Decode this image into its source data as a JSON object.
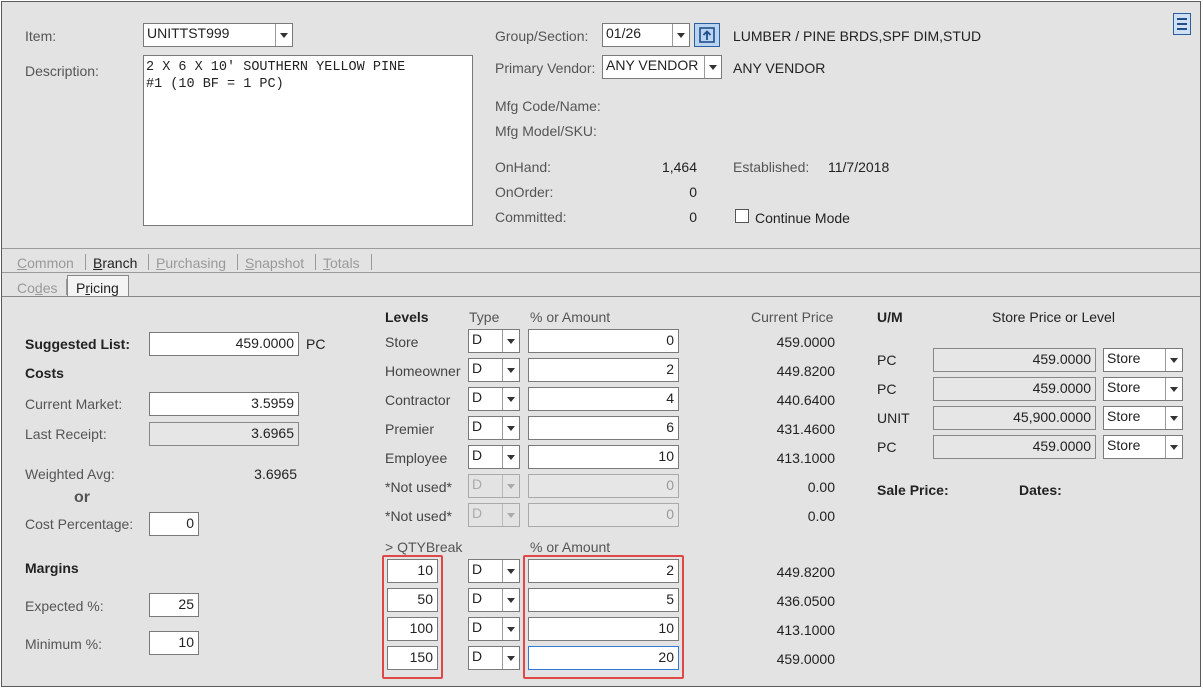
{
  "header": {
    "item_label": "Item:",
    "item_value": "UNITTST999",
    "description_label": "Description:",
    "description_value": "2 X 6 X 10' SOUTHERN YELLOW PINE\n#1 (10 BF = 1 PC)",
    "group_section_label": "Group/Section:",
    "group_section_value": "01/26",
    "group_section_desc": "LUMBER / PINE BRDS,SPF DIM,STUD",
    "primary_vendor_label": "Primary Vendor:",
    "primary_vendor_value": "ANY VENDOR",
    "primary_vendor_desc": "ANY VENDOR",
    "mfg_code_label": "Mfg Code/Name:",
    "mfg_model_label": "Mfg Model/SKU:",
    "onhand_label": "OnHand:",
    "onhand_value": "1,464",
    "onorder_label": "OnOrder:",
    "onorder_value": "0",
    "committed_label": "Committed:",
    "committed_value": "0",
    "established_label": "Established:",
    "established_value": "11/7/2018",
    "continue_mode_label": "Continue Mode",
    "continue_mode_checked": false
  },
  "tabs": [
    {
      "pre": "",
      "u": "C",
      "post": "ommon",
      "active": false
    },
    {
      "pre": "",
      "u": "B",
      "post": "ranch",
      "active": true
    },
    {
      "pre": "",
      "u": "P",
      "post": "urchasing",
      "active": false
    },
    {
      "pre": "",
      "u": "S",
      "post": "napshot",
      "active": false
    },
    {
      "pre": "",
      "u": "T",
      "post": "otals",
      "active": false
    }
  ],
  "subtabs": [
    {
      "pre": "Co",
      "u": "d",
      "post": "es",
      "active": false
    },
    {
      "pre": "P",
      "u": "r",
      "post": "icing",
      "active": true
    }
  ],
  "pricing": {
    "suggested_list_label": "Suggested List:",
    "suggested_list_value": "459.0000",
    "suggested_list_um": "PC",
    "costs_label": "Costs",
    "current_market_label": "Current Market:",
    "current_market_value": "3.5959",
    "last_receipt_label": "Last Receipt:",
    "last_receipt_value": "3.6965",
    "weighted_avg_label": "Weighted Avg:",
    "weighted_avg_value": "3.6965",
    "or_label": "or",
    "cost_percentage_label": "Cost Percentage:",
    "cost_percentage_value": "0",
    "margins_label": "Margins",
    "expected_label": "Expected %:",
    "expected_value": "25",
    "minimum_label": "Minimum %:",
    "minimum_value": "10"
  },
  "levels": {
    "levels_header": "Levels",
    "type_header": "Type",
    "amount_header": "% or Amount",
    "current_price_header": "Current Price",
    "rows": [
      {
        "name": "Store",
        "type": "D",
        "amount": "0",
        "price": "459.0000",
        "disabled": false
      },
      {
        "name": "Homeowner",
        "type": "D",
        "amount": "2",
        "price": "449.8200",
        "disabled": false
      },
      {
        "name": "Contractor",
        "type": "D",
        "amount": "4",
        "price": "440.6400",
        "disabled": false
      },
      {
        "name": "Premier",
        "type": "D",
        "amount": "6",
        "price": "431.4600",
        "disabled": false
      },
      {
        "name": "Employee",
        "type": "D",
        "amount": "10",
        "price": "413.1000",
        "disabled": false
      },
      {
        "name": "*Not used*",
        "type": "D",
        "amount": "0",
        "price": "0.00",
        "disabled": true
      },
      {
        "name": "*Not used*",
        "type": "D",
        "amount": "0",
        "price": "0.00",
        "disabled": true
      }
    ]
  },
  "qtybreak": {
    "qty_header": "> QTYBreak",
    "amount_header": "% or Amount",
    "rows": [
      {
        "qty": "10",
        "type": "D",
        "amount": "2",
        "price": "449.8200"
      },
      {
        "qty": "50",
        "type": "D",
        "amount": "5",
        "price": "436.0500"
      },
      {
        "qty": "100",
        "type": "D",
        "amount": "10",
        "price": "413.1000"
      },
      {
        "qty": "150",
        "type": "D",
        "amount": "20",
        "price": "459.0000"
      }
    ]
  },
  "um": {
    "um_header": "U/M",
    "store_price_header": "Store Price or Level",
    "rows": [
      {
        "um": "PC",
        "price": "459.0000",
        "level": "Store"
      },
      {
        "um": "PC",
        "price": "459.0000",
        "level": "Store"
      },
      {
        "um": "UNIT",
        "price": "45,900.0000",
        "level": "Store"
      },
      {
        "um": "PC",
        "price": "459.0000",
        "level": "Store"
      }
    ],
    "sale_price_label": "Sale Price:",
    "dates_label": "Dates:"
  }
}
